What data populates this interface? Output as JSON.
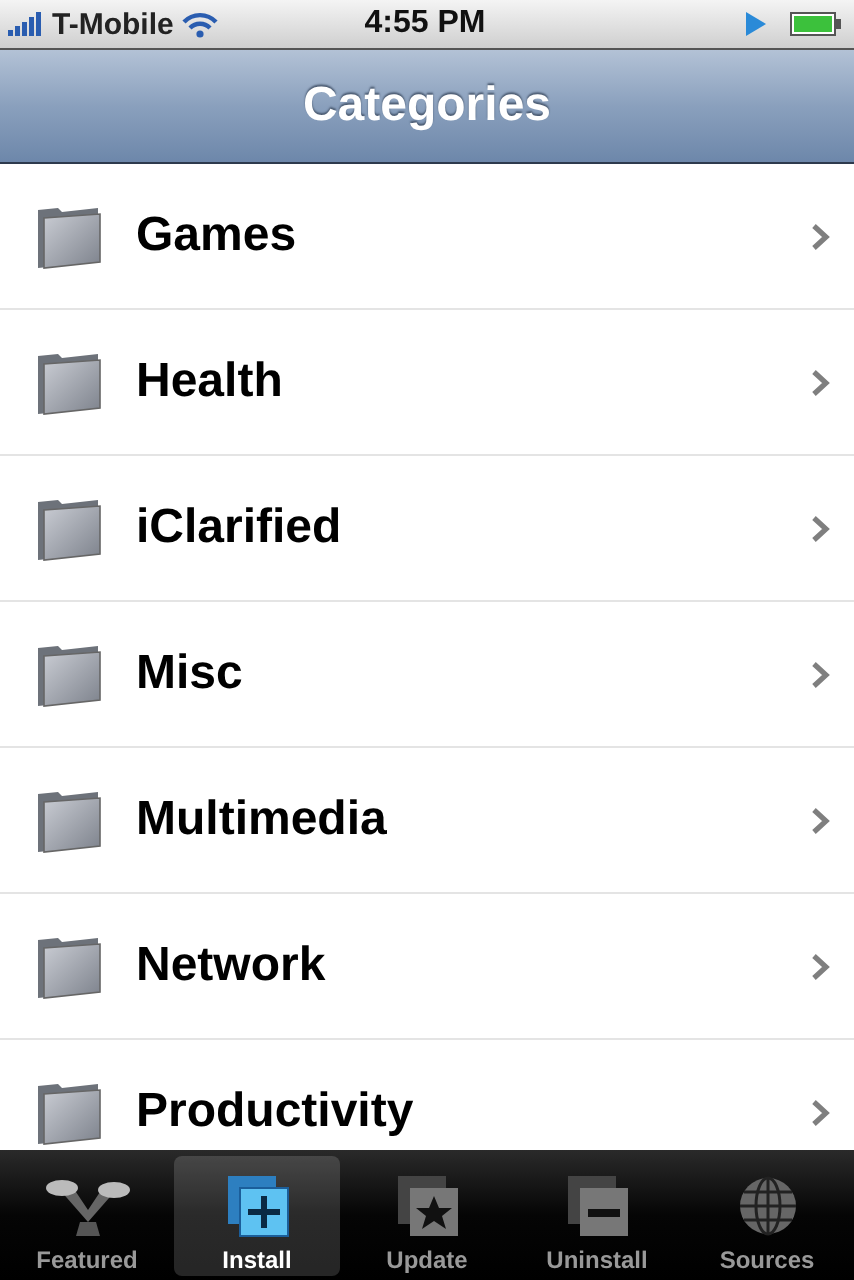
{
  "status_bar": {
    "carrier": "T-Mobile",
    "time": "4:55 PM"
  },
  "nav_bar": {
    "title": "Categories"
  },
  "categories": [
    {
      "label": "Games"
    },
    {
      "label": "Health"
    },
    {
      "label": "iClarified"
    },
    {
      "label": "Misc"
    },
    {
      "label": "Multimedia"
    },
    {
      "label": "Network"
    },
    {
      "label": "Productivity"
    }
  ],
  "tabs": [
    {
      "label": "Featured",
      "kind": "featured",
      "selected": false
    },
    {
      "label": "Install",
      "kind": "install",
      "selected": true
    },
    {
      "label": "Update",
      "kind": "update",
      "selected": false
    },
    {
      "label": "Uninstall",
      "kind": "uninstall",
      "selected": false
    },
    {
      "label": "Sources",
      "kind": "sources",
      "selected": false
    }
  ]
}
